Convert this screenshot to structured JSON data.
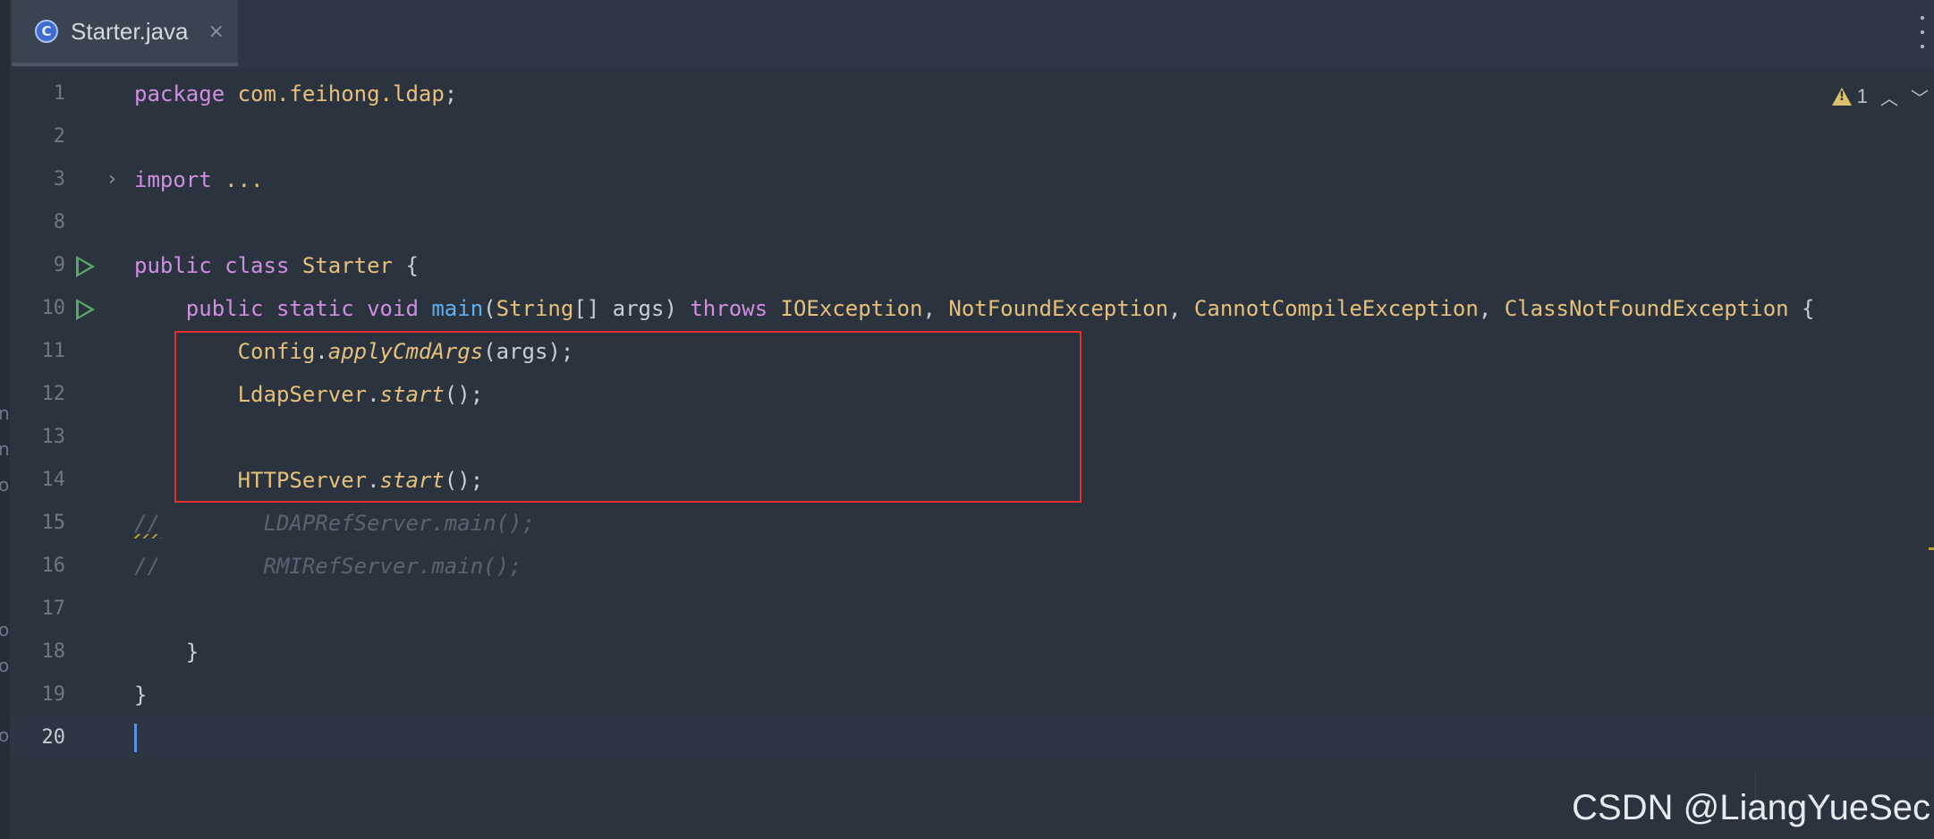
{
  "tab": {
    "label": "Starter.java",
    "icon": "class-icon",
    "icon_letter": "C",
    "close": "×"
  },
  "inspection": {
    "warning_count": "1"
  },
  "lines": {
    "l1": {
      "num": "1",
      "package_kw": "package",
      "package_name": "com.feihong.ldap",
      "semi": ";"
    },
    "l2": {
      "num": "2"
    },
    "l3": {
      "num": "3",
      "fold": "›",
      "import_kw": "import",
      "dots": "..."
    },
    "l8": {
      "num": "8"
    },
    "l9": {
      "num": "9",
      "public": "public",
      "class_kw": "class",
      "name": "Starter",
      "brace": "{"
    },
    "l10": {
      "num": "10",
      "public": "public",
      "static": "static",
      "void": "void",
      "main": "main",
      "params_open": "(",
      "string_type": "String",
      "params_rest": "[] args)",
      "throws": "throws",
      "ex1": "IOException",
      "ex2": "NotFoundException",
      "ex3": "CannotCompileException",
      "ex4": "ClassNotFoundException",
      "comma": ", ",
      "brace": " {"
    },
    "l11": {
      "num": "11",
      "obj": "Config",
      "dot": ".",
      "method": "applyCmdArgs",
      "args": "(args);"
    },
    "l12": {
      "num": "12",
      "obj": "LdapServer",
      "dot": ".",
      "method": "start",
      "args": "();"
    },
    "l13": {
      "num": "13"
    },
    "l14": {
      "num": "14",
      "obj": "HTTPServer",
      "dot": ".",
      "method": "start",
      "args": "();"
    },
    "l15": {
      "num": "15",
      "slashes": "//",
      "text": "        LDAPRefServer.main();"
    },
    "l16": {
      "num": "16",
      "slashes": "//",
      "text": "        RMIRefServer.main();"
    },
    "l17": {
      "num": "17"
    },
    "l18": {
      "num": "18",
      "brace": "    }"
    },
    "l19": {
      "num": "19",
      "brace": "}"
    },
    "l20": {
      "num": "20"
    }
  },
  "left_fragments": [
    "n",
    "n",
    "o",
    "o",
    "o",
    "o"
  ],
  "watermark": "CSDN @LiangYueSec"
}
